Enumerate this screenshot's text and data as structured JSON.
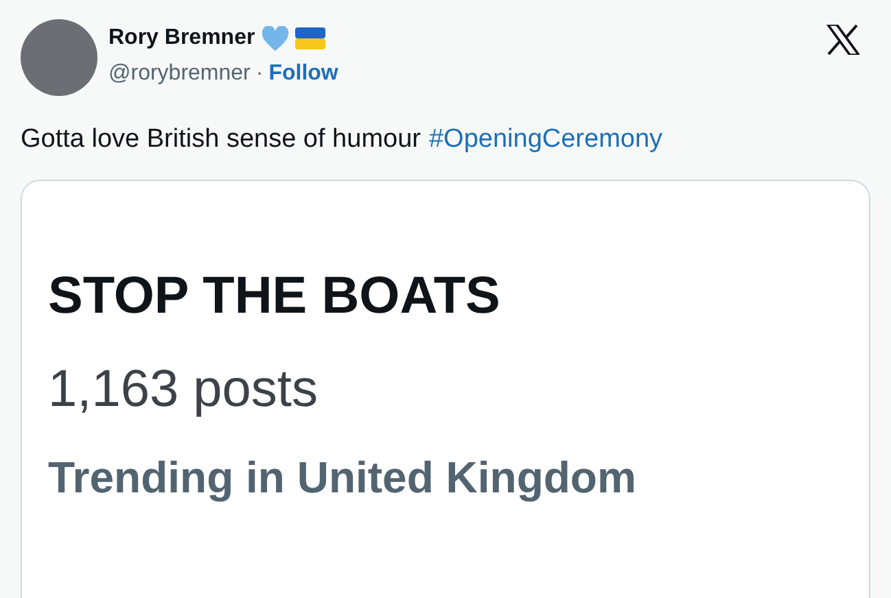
{
  "author": {
    "name": "Rory Bremner",
    "handle": "@rorybremner",
    "separator": "·",
    "follow": "Follow"
  },
  "tweet": {
    "text": "Gotta love British sense of humour",
    "hashtag": "#OpeningCeremony"
  },
  "card": {
    "headline": "STOP THE BOATS",
    "count": "1,163 posts",
    "trend": "Trending in United Kingdom"
  }
}
